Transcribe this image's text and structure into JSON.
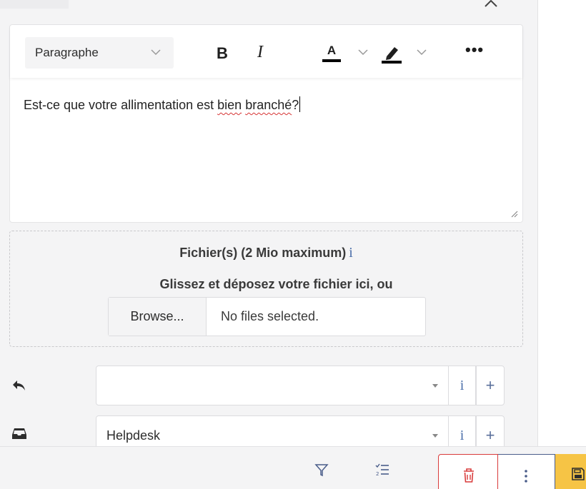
{
  "editor": {
    "paragraph_style": "Paragraphe",
    "bold_label": "B",
    "italic_label": "I",
    "font_color_letter": "A",
    "more_label": "•••",
    "content_before": "Est-ce que votre allimentation est ",
    "misspelled_1": "bien",
    "content_space": " ",
    "misspelled_2": "branché",
    "content_after": "?"
  },
  "dropzone": {
    "title": "Fichier(s) (2 Mio maximum)",
    "info_label": "i",
    "drag_text": "Glissez et déposez votre fichier ici, ou",
    "browse_label": "Browse...",
    "file_status": "No files selected."
  },
  "fields": [
    {
      "icon": "reply-icon",
      "value": "",
      "info_label": "i",
      "add_label": "+"
    },
    {
      "icon": "inbox-icon",
      "value": "Helpdesk",
      "info_label": "i",
      "add_label": "+"
    }
  ],
  "footer": {
    "icons": [
      "filter-icon",
      "checklist-icon",
      "trash-icon",
      "kebab-icon",
      "save-icon"
    ],
    "delete_color": "#d93b3b",
    "save_color": "#f6c445"
  }
}
